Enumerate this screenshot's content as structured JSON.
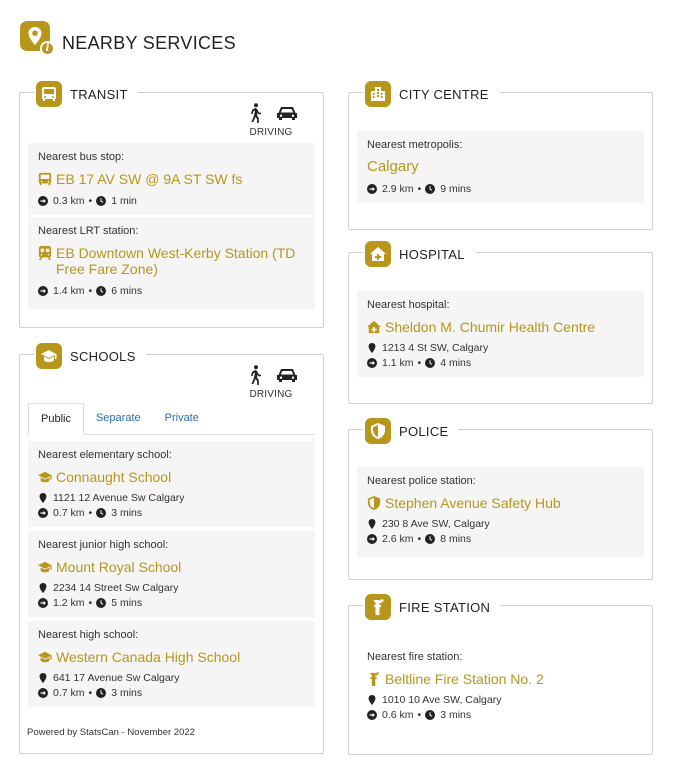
{
  "header": {
    "title": "NEARBY SERVICES"
  },
  "transit": {
    "title": "TRANSIT",
    "mode_label": "DRIVING",
    "entries": [
      {
        "label": "Nearest bus stop:",
        "name": "EB 17 AV SW @ 9A ST SW fs",
        "distance": "0.3 km",
        "time": "1 min"
      },
      {
        "label": "Nearest LRT station:",
        "name": "EB Downtown West-Kerby Station (TD Free Fare Zone)",
        "distance": "1.4 km",
        "time": "6 mins"
      }
    ]
  },
  "schools": {
    "title": "SCHOOLS",
    "mode_label": "DRIVING",
    "tabs": [
      "Public",
      "Separate",
      "Private"
    ],
    "entries": [
      {
        "label": "Nearest elementary school:",
        "name": "Connaught School",
        "address": "1121 12 Avenue Sw Calgary",
        "distance": "0.7 km",
        "time": "3 mins"
      },
      {
        "label": "Nearest junior high school:",
        "name": "Mount Royal School",
        "address": "2234 14 Street Sw Calgary",
        "distance": "1.2 km",
        "time": "5 mins"
      },
      {
        "label": "Nearest high school:",
        "name": "Western Canada High School",
        "address": "641 17 Avenue Sw Calgary",
        "distance": "0.7 km",
        "time": "3 mins"
      }
    ]
  },
  "city_centre": {
    "title": "CITY CENTRE",
    "entry": {
      "label": "Nearest metropolis:",
      "name": "Calgary",
      "distance": "2.9 km",
      "time": "9 mins"
    }
  },
  "hospital": {
    "title": "HOSPITAL",
    "entry": {
      "label": "Nearest hospital:",
      "name": "Sheldon M. Chumir Health Centre",
      "address": "1213 4 St SW, Calgary",
      "distance": "1.1 km",
      "time": "4 mins"
    }
  },
  "police": {
    "title": "POLICE",
    "entry": {
      "label": "Nearest police station:",
      "name": "Stephen Avenue Safety Hub",
      "address": "230 8 Ave SW, Calgary",
      "distance": "2.6 km",
      "time": "8 mins"
    }
  },
  "fire": {
    "title": "FIRE STATION",
    "entry": {
      "label": "Nearest fire station:",
      "name": "Beltline Fire Station No. 2",
      "address": "1010 10 Ave SW, Calgary",
      "distance": "0.6 km",
      "time": "3 mins"
    }
  },
  "footer": {
    "text": "Powered by StatsCan - November 2022"
  },
  "colors": {
    "accent": "#b8961c",
    "link": "#2a6fb0"
  }
}
